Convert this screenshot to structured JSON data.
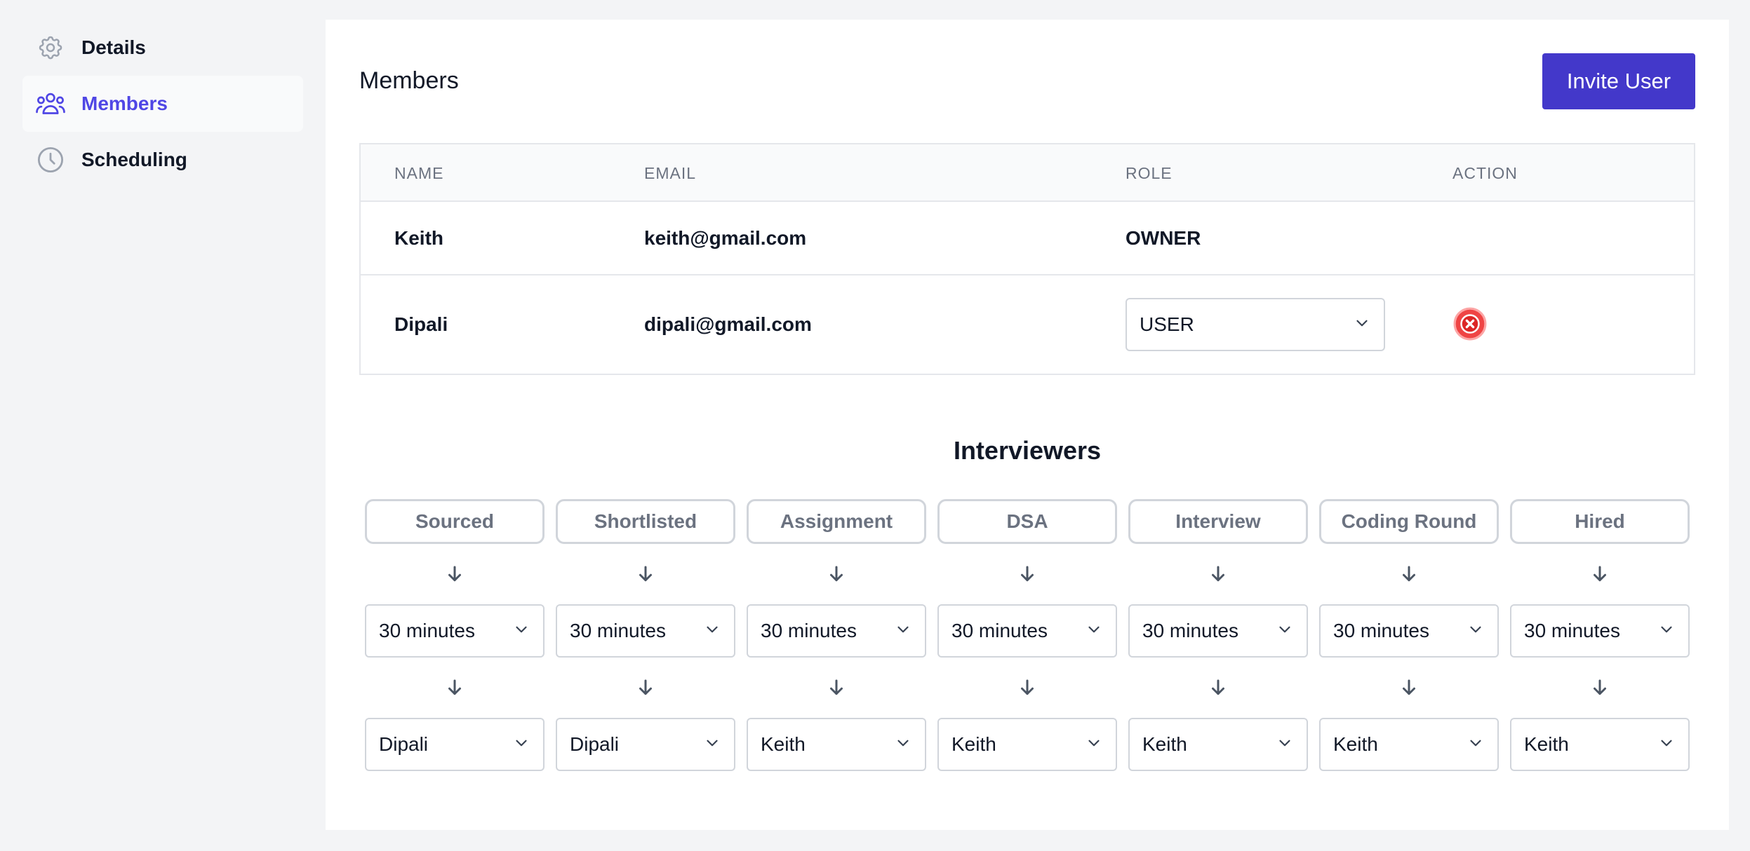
{
  "sidebar": {
    "items": [
      {
        "label": "Details",
        "icon": "gear-icon",
        "active": false
      },
      {
        "label": "Members",
        "icon": "users-icon",
        "active": true
      },
      {
        "label": "Scheduling",
        "icon": "clock-icon",
        "active": false
      }
    ]
  },
  "members": {
    "title": "Members",
    "invite_label": "Invite User",
    "columns": [
      "NAME",
      "EMAIL",
      "ROLE",
      "ACTION"
    ],
    "rows": [
      {
        "name": "Keith",
        "email": "keith@gmail.com",
        "role": "OWNER"
      },
      {
        "name": "Dipali",
        "email": "dipali@gmail.com",
        "role": "USER"
      }
    ]
  },
  "interviewers": {
    "title": "Interviewers",
    "stages": [
      {
        "name": "Sourced",
        "duration": "30 minutes",
        "interviewer": "Dipali"
      },
      {
        "name": "Shortlisted",
        "duration": "30 minutes",
        "interviewer": "Dipali"
      },
      {
        "name": "Assignment",
        "duration": "30 minutes",
        "interviewer": "Keith"
      },
      {
        "name": "DSA",
        "duration": "30 minutes",
        "interviewer": "Keith"
      },
      {
        "name": "Interview",
        "duration": "30 minutes",
        "interviewer": "Keith"
      },
      {
        "name": "Coding Round",
        "duration": "30 minutes",
        "interviewer": "Keith"
      },
      {
        "name": "Hired",
        "duration": "30 minutes",
        "interviewer": "Keith"
      }
    ]
  },
  "colors": {
    "accent": "#4f46e5",
    "button": "#4338ca",
    "danger": "#dc2626"
  }
}
